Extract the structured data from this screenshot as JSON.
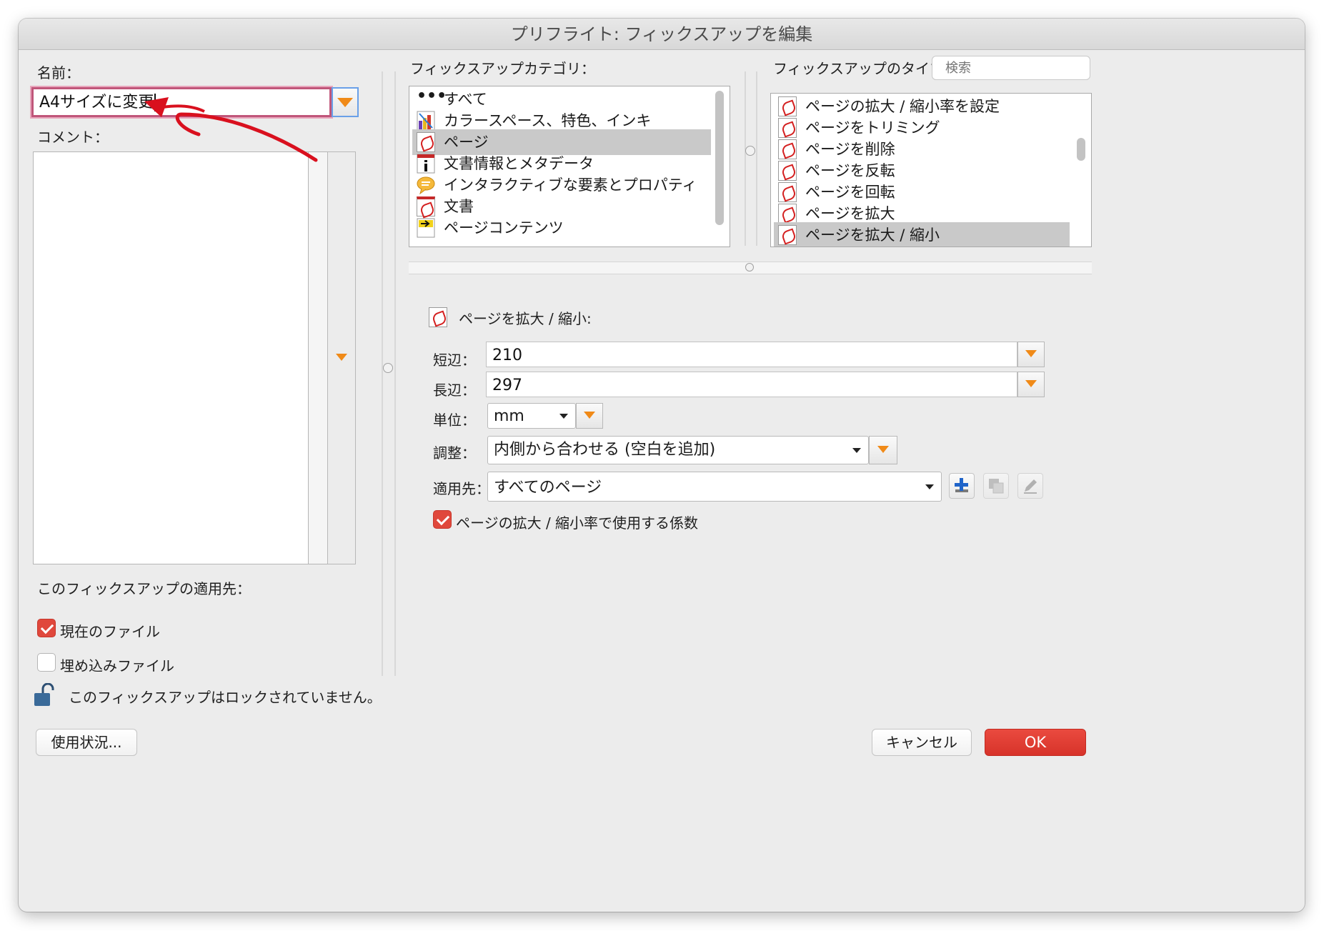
{
  "window": {
    "title": "プリフライト: フィックスアップを編集"
  },
  "left": {
    "name_label": "名前：",
    "name_value": "A4サイズに変更",
    "comment_label": "コメント：",
    "apply_label": "このフィックスアップの適用先：",
    "current_file_label": "現在のファイル",
    "embedded_file_label": "埋め込みファイル",
    "lock_text": "このフィックスアップはロックされていません。"
  },
  "categories": {
    "label": "フィックスアップカテゴリ：",
    "items": [
      {
        "label": "すべて",
        "icon": "ellipsis-icon"
      },
      {
        "label": "カラースペース、特色、インキ",
        "icon": "colorspace-icon"
      },
      {
        "label": "ページ",
        "icon": "pdf-page-icon"
      },
      {
        "label": "文書情報とメタデータ",
        "icon": "info-icon"
      },
      {
        "label": "インタラクティブな要素とプロパティ",
        "icon": "comment-bubble-icon"
      },
      {
        "label": "文書",
        "icon": "pdf-document-icon"
      },
      {
        "label": "ページコンテンツ",
        "icon": "page-content-icon"
      }
    ],
    "selected": "ページ"
  },
  "types": {
    "label": "フィックスアップのタイプ：",
    "search_placeholder": "検索",
    "items": [
      "ページの拡大 / 縮小率を設定",
      "ページをトリミング",
      "ページを削除",
      "ページを反転",
      "ページを回転",
      "ページを拡大",
      "ページを拡大 / 縮小"
    ],
    "selected": "ページを拡大 / 縮小"
  },
  "detail": {
    "header": "ページを拡大 / 縮小:",
    "short_label": "短辺：",
    "short_value": "210",
    "long_label": "長辺：",
    "long_value": "297",
    "unit_label": "単位：",
    "unit_value": "mm",
    "fit_label": "調整：",
    "fit_value": "内側から合わせる (空白を追加)",
    "apply_label": "適用先：",
    "apply_value": "すべてのページ",
    "factor_label": "ページの拡大 / 縮小率で使用する係数"
  },
  "buttons": {
    "usage": "使用状況...",
    "cancel": "キャンセル",
    "ok": "OK"
  },
  "colors": {
    "accent_orange": "#f08a18",
    "checkbox_red": "#e0483c",
    "ok_red": "#d7332a",
    "annotation_red": "#d9101e"
  }
}
